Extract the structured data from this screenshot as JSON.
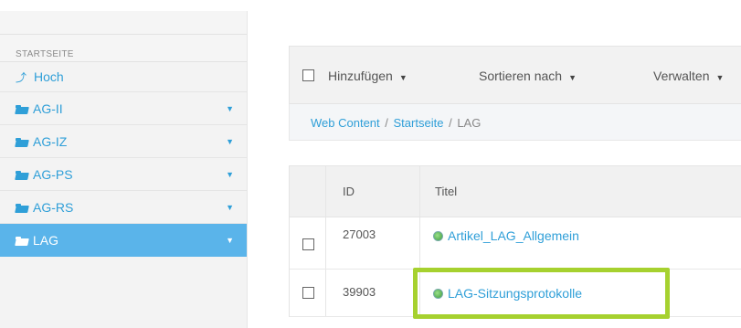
{
  "sidebar": {
    "header": "STARTSEITE",
    "up_label": "Hoch",
    "items": [
      {
        "label": "AG-II"
      },
      {
        "label": "AG-IZ"
      },
      {
        "label": "AG-PS"
      },
      {
        "label": "AG-RS"
      },
      {
        "label": "LAG",
        "active": true
      }
    ]
  },
  "toolbar": {
    "add_label": "Hinzufügen",
    "sort_label": "Sortieren nach",
    "manage_label": "Verwalten"
  },
  "breadcrumb": {
    "items": [
      "Web Content",
      "Startseite"
    ],
    "separator": "/",
    "current": "LAG"
  },
  "table": {
    "columns": {
      "id": "ID",
      "title": "Titel"
    },
    "rows": [
      {
        "id": "27003",
        "title": "Artikel_LAG_Allgemein"
      },
      {
        "id": "39903",
        "title": "LAG-Sitzungsprotokolle",
        "highlighted": true
      }
    ]
  },
  "colors": {
    "link": "#2f9fd8",
    "active_bg": "#5ab4ea",
    "highlight_border": "#a6d12f"
  }
}
